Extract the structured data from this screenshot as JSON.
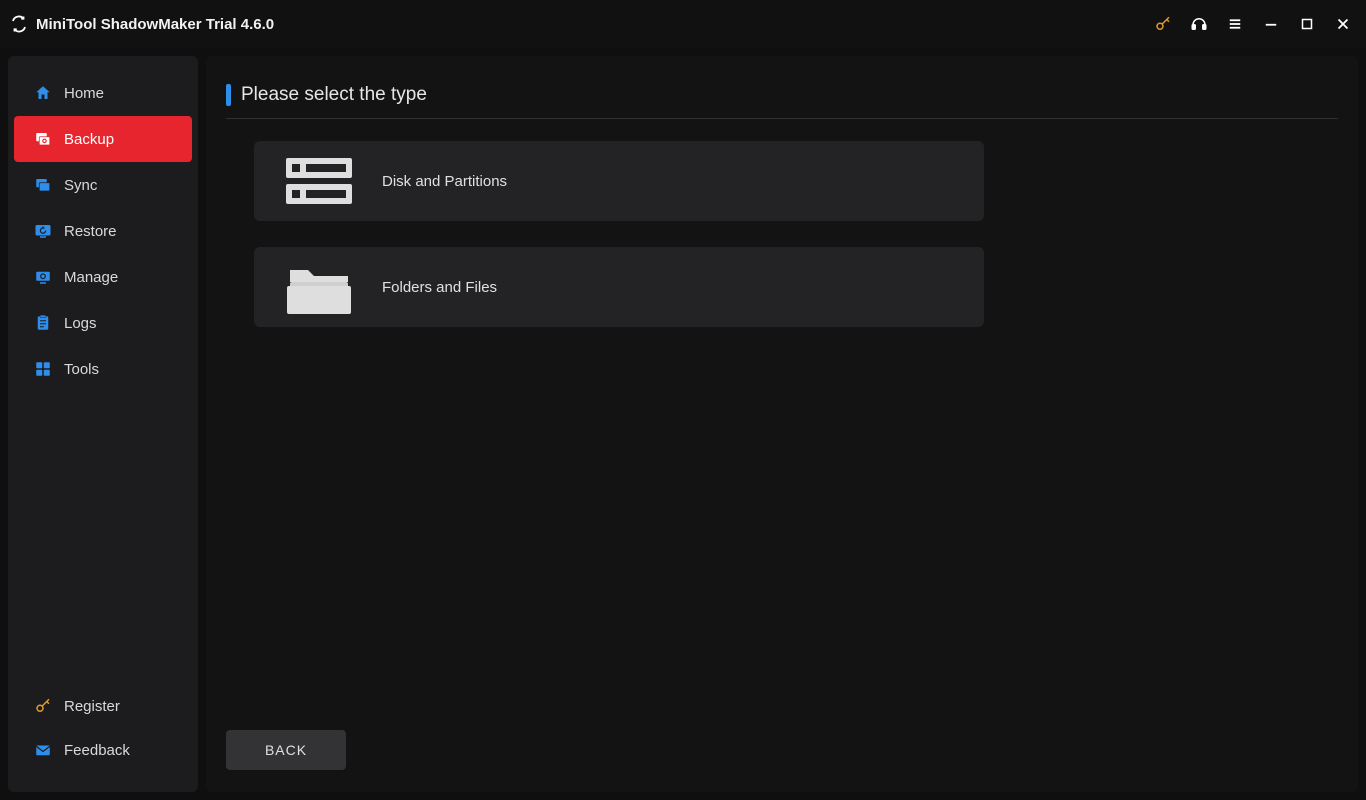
{
  "titlebar": {
    "title": "MiniTool ShadowMaker Trial 4.6.0"
  },
  "sidebar": {
    "items": [
      {
        "label": "Home"
      },
      {
        "label": "Backup"
      },
      {
        "label": "Sync"
      },
      {
        "label": "Restore"
      },
      {
        "label": "Manage"
      },
      {
        "label": "Logs"
      },
      {
        "label": "Tools"
      }
    ],
    "bottom": [
      {
        "label": "Register"
      },
      {
        "label": "Feedback"
      }
    ]
  },
  "main": {
    "heading": "Please select the type",
    "options": [
      {
        "label": "Disk and Partitions"
      },
      {
        "label": "Folders and Files"
      }
    ],
    "back": "BACK"
  },
  "colors": {
    "accent_blue": "#2f8eea",
    "accent_red": "#e6252e",
    "key_orange": "#e09a2b"
  }
}
